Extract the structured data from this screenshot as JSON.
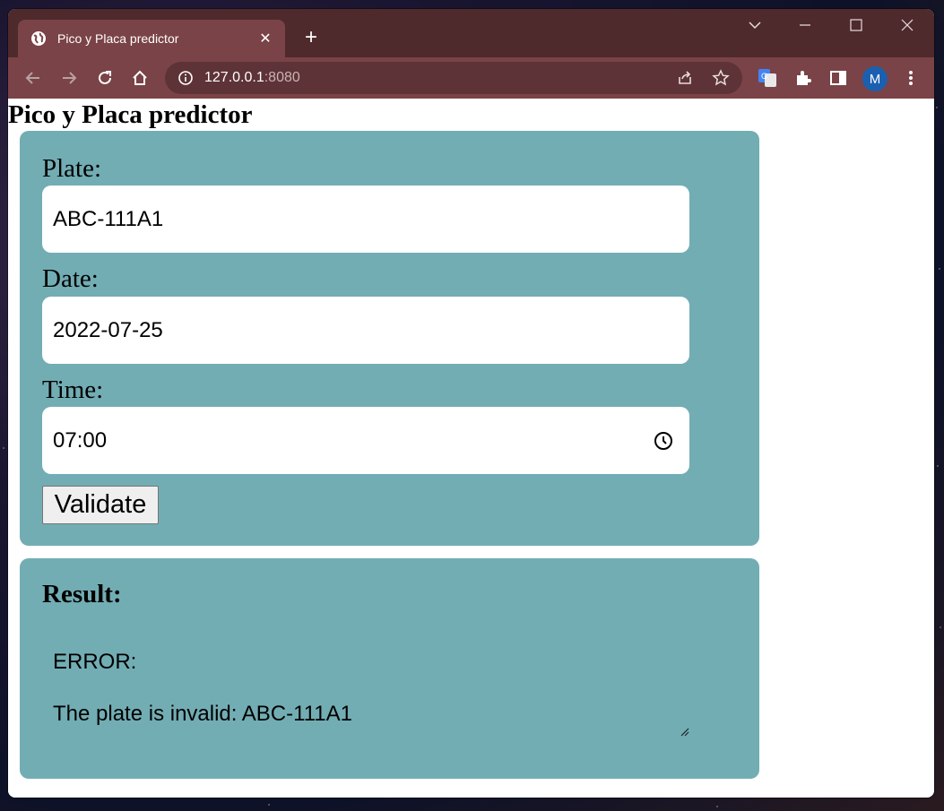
{
  "browser": {
    "tab_title": "Pico y Placa predictor",
    "url_host": "127.0.0.1",
    "url_port": ":8080",
    "profile_initial": "M"
  },
  "page": {
    "title": "Pico y Placa predictor",
    "form": {
      "plate_label": "Plate:",
      "plate_value": "ABC-111A1",
      "date_label": "Date:",
      "date_value": "2022-07-25",
      "time_label": "Time:",
      "time_value": "07:00",
      "validate_label": "Validate"
    },
    "result": {
      "heading": "Result:",
      "line1": "ERROR:",
      "line2": "The plate is invalid: ABC-111A1"
    }
  },
  "colors": {
    "panel": "#72adb4",
    "titlebar": "#4e2a2d",
    "toolbar": "#7a4347"
  }
}
